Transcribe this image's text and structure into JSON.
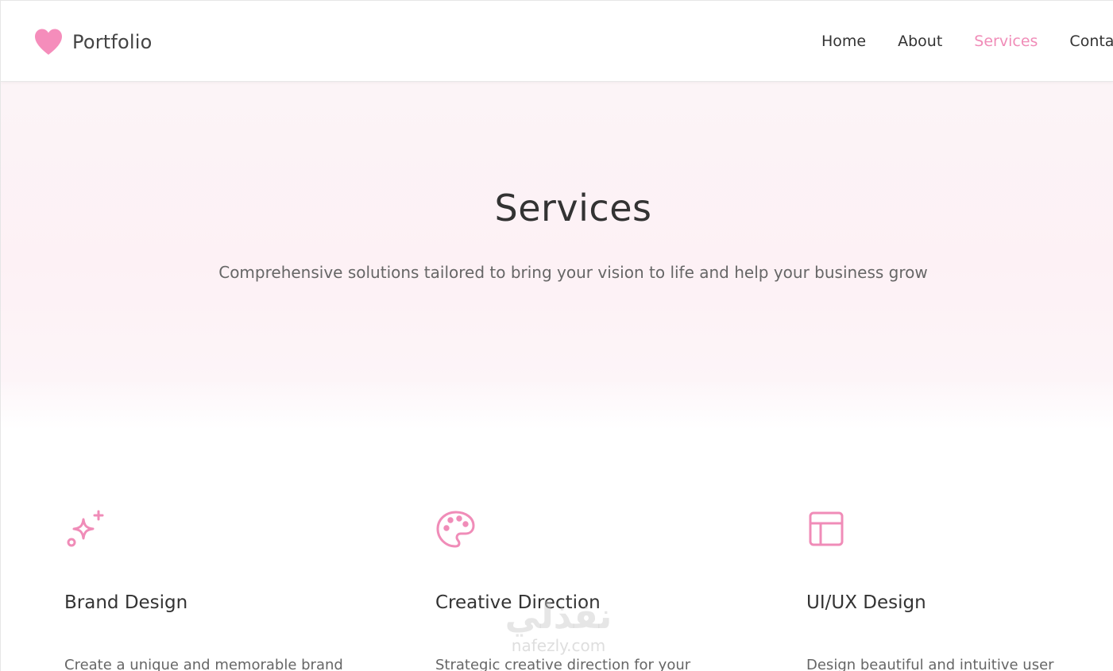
{
  "header": {
    "brand": "Portfolio",
    "nav": [
      {
        "label": "Home",
        "active": false
      },
      {
        "label": "About",
        "active": false
      },
      {
        "label": "Services",
        "active": true
      },
      {
        "label": "Contact",
        "active": false
      }
    ]
  },
  "hero": {
    "title": "Services",
    "subtitle": "Comprehensive solutions tailored to bring your vision to life and help your business grow"
  },
  "services": [
    {
      "icon": "sparkles-icon",
      "title": "Brand Design",
      "description": "Create a unique and memorable brand"
    },
    {
      "icon": "palette-icon",
      "title": "Creative Direction",
      "description": "Strategic creative direction for your"
    },
    {
      "icon": "layout-icon",
      "title": "UI/UX Design",
      "description": "Design beautiful and intuitive user"
    }
  ],
  "watermark": {
    "arabic": "نفذلي",
    "latin": "nafezly.com"
  },
  "colors": {
    "accent": "#f08cb8",
    "text": "#333333",
    "muted": "#666666"
  }
}
